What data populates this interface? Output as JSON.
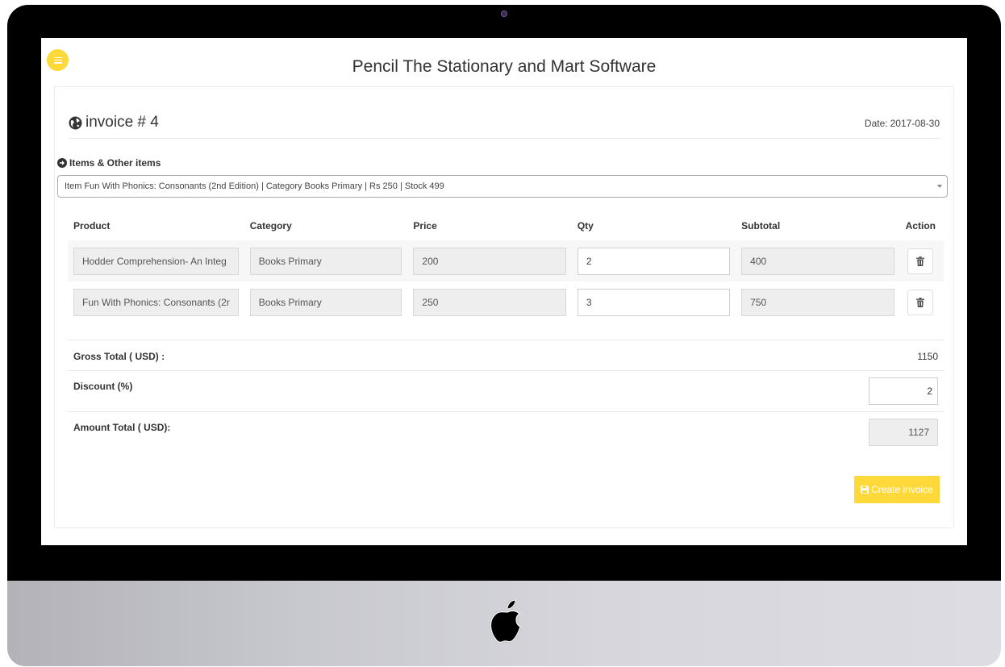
{
  "app": {
    "title": "Pencil The Stationary and Mart Software"
  },
  "invoice": {
    "title": "invoice # 4",
    "date_label": "Date:",
    "date_value": "2017-08-30"
  },
  "items_section": {
    "label": "Items & Other items",
    "select_value": "Item Fun With Phonics: Consonants (2nd Edition) | Category Books Primary | Rs 250 | Stock 499"
  },
  "table": {
    "headers": [
      "Product",
      "Category",
      "Price",
      "Qty",
      "Subtotal",
      "Action"
    ],
    "rows": [
      {
        "product": "Hodder Comprehension- An Integ",
        "category": "Books Primary",
        "price": "200",
        "qty": "2",
        "subtotal": "400"
      },
      {
        "product": "Fun With Phonics: Consonants (2r",
        "category": "Books Primary",
        "price": "250",
        "qty": "3",
        "subtotal": "750"
      }
    ]
  },
  "summary": {
    "gross_label": "Gross Total ( USD) :",
    "gross_value": "1150",
    "discount_label": "Discount (%)",
    "discount_value": "2",
    "amount_label": "Amount Total ( USD):",
    "amount_value": "1127"
  },
  "actions": {
    "create_label": "Create invoice"
  },
  "icons": {
    "menu": "menu-icon",
    "globe": "globe-icon",
    "arrow": "circle-arrow-right-icon",
    "trash": "trash-icon",
    "save": "floppy-disk-icon",
    "apple": "apple-logo"
  },
  "colors": {
    "accent": "#ffd83a",
    "bezel": "#000000"
  }
}
